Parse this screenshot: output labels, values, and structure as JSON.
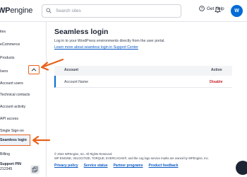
{
  "header": {
    "logo_wp": "WP",
    "logo_engine": "engine",
    "logo_suffix": "®",
    "search_placeholder": "Search sites",
    "help_label": "Get help",
    "avatar_initial": "W"
  },
  "sidebar": {
    "items": [
      {
        "label": "ites"
      },
      {
        "label": "eCommerce"
      },
      {
        "label": "Products"
      },
      {
        "label": "Isers"
      },
      {
        "label": "Account users"
      },
      {
        "label": "Technical contacts"
      },
      {
        "label": "Account activity"
      },
      {
        "label": "API access"
      },
      {
        "label": "Single Sign-on"
      },
      {
        "label": "Seamless login"
      },
      {
        "label": "Billing"
      }
    ],
    "support_label": "Support PIN",
    "support_pin": "212345"
  },
  "main": {
    "title": "Seamless login",
    "description": "Log in to your WordPress environments directly from the user portal.",
    "learn_link": "Learn more about seamless login in Support Center",
    "table": {
      "headers": {
        "account": "Account",
        "action": "Action"
      },
      "rows": [
        {
          "account": "Account Name",
          "action": "Disable"
        }
      ]
    },
    "footer": {
      "copyright": "© 2024 WPEngine, Inc. All Rights Reserved.",
      "trademark": "WP ENGINE, VELOCITIZE, TORQUE, EVERCACHE®, and the cog logo service marks are owned by WPEngine, Inc.",
      "links": [
        "Privacy policy",
        "Service status",
        "Partner programs",
        "Product feedback"
      ]
    }
  },
  "colors": {
    "accent": "#006bd6",
    "annotation": "#e8611a",
    "danger": "#c2262e"
  }
}
